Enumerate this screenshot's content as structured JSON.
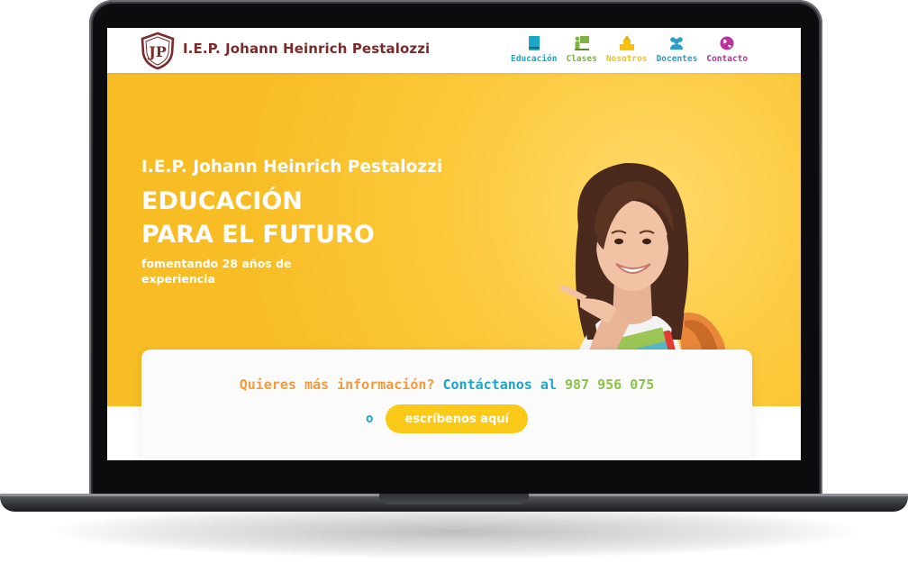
{
  "header": {
    "brand": "I.E.P. Johann Heinrich Pestalozzi",
    "logo_initials": "JP",
    "brand_color": "#7a2b2b"
  },
  "nav": {
    "items": [
      {
        "label": "Educación",
        "icon": "book-icon",
        "color": "#1aa6c8"
      },
      {
        "label": "Clases",
        "icon": "classroom-icon",
        "color": "#7cb342"
      },
      {
        "label": "Nosotros",
        "icon": "building-icon",
        "color": "#f4c20d"
      },
      {
        "label": "Docentes",
        "icon": "people-icon",
        "color": "#2a9ec9"
      },
      {
        "label": "Contacto",
        "icon": "globe-icon",
        "color": "#b7329b"
      }
    ]
  },
  "hero": {
    "school": "I.E.P. Johann Heinrich Pestalozzi",
    "title_line1": "EDUCACIÓN",
    "title_line2": "PARA EL FUTURO",
    "subtitle": "fomentando 28 años de experiencia",
    "background": "#f8bd25"
  },
  "contact": {
    "question": "Quieres más información?",
    "contact_word": "Contáctanos al",
    "phone": "987 956 075",
    "or": "o",
    "cta": "escríbenos aquí",
    "colors": {
      "question": "#f39a3c",
      "contact": "#1aa6c8",
      "phone": "#8bc34a",
      "cta": "#fbc918"
    }
  }
}
